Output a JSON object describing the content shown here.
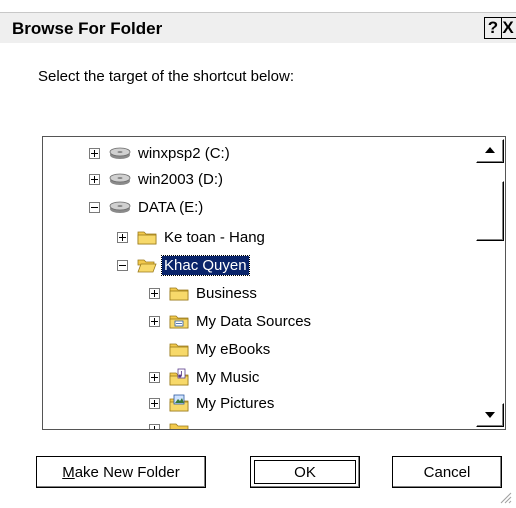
{
  "window": {
    "title": "Browse For Folder",
    "help_label": "?",
    "close_label": "X"
  },
  "prompt": "Select the target of the shortcut below:",
  "tree": {
    "items": [
      {
        "label": "winxpsp2 (C:)",
        "icon": "drive-icon",
        "expander": "plus"
      },
      {
        "label": "win2003 (D:)",
        "icon": "drive-icon",
        "expander": "plus"
      },
      {
        "label": "DATA (E:)",
        "icon": "drive-icon",
        "expander": "minus"
      },
      {
        "label": "Ke toan - Hang",
        "icon": "folder-icon",
        "expander": "plus"
      },
      {
        "label": "Khac Quyen",
        "icon": "folder-open-icon",
        "expander": "minus",
        "selected": true
      },
      {
        "label": "Business",
        "icon": "folder-icon",
        "expander": "plus"
      },
      {
        "label": "My Data Sources",
        "icon": "data-sources-folder-icon",
        "expander": "plus"
      },
      {
        "label": "My eBooks",
        "icon": "folder-icon",
        "expander": "none"
      },
      {
        "label": "My Music",
        "icon": "music-folder-icon",
        "expander": "plus"
      },
      {
        "label": "My Pictures",
        "icon": "pictures-folder-icon",
        "expander": "plus"
      }
    ]
  },
  "buttons": {
    "make_new_folder_prefix": "M",
    "make_new_folder_rest": "ake New Folder",
    "ok": "OK",
    "cancel": "Cancel"
  },
  "colors": {
    "selection": "#0a246a",
    "folder": "#f2c94c"
  }
}
